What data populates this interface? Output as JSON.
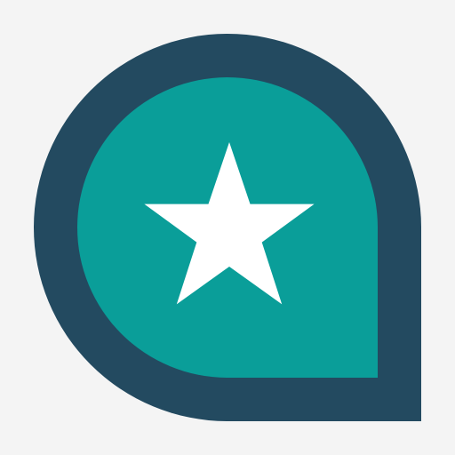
{
  "icon": {
    "name": "star-pin-icon",
    "shape": "teardrop-pin",
    "glyph": "star-icon"
  },
  "colors": {
    "background": "#f4f4f4",
    "outer_ring": "#234a60",
    "inner_fill": "#0a9e99",
    "star": "#ffffff"
  }
}
